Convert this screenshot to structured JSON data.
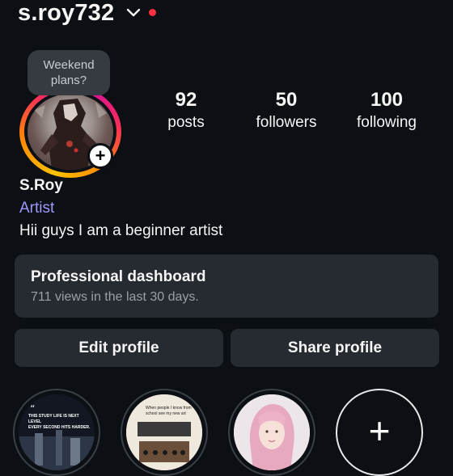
{
  "header": {
    "username": "s.roy732"
  },
  "story_bubble": {
    "line1": "Weekend",
    "line2": "plans?"
  },
  "stats": [
    {
      "value": "92",
      "label": "posts"
    },
    {
      "value": "50",
      "label": "followers"
    },
    {
      "value": "100",
      "label": "following"
    }
  ],
  "profile": {
    "name": "S.Roy",
    "category": "Artist",
    "bio": "Hii guys I am a beginner artist"
  },
  "dashboard": {
    "title": "Professional dashboard",
    "subtitle": "711 views in the last 30 days."
  },
  "buttons": {
    "edit": "Edit profile",
    "share": "Share profile"
  },
  "highlight_text": {
    "h1": [
      "THIS STUDY LIFE IS NEXT LEVEL",
      "EVERY SECOND HITS HARDER."
    ],
    "h2": [
      "When people I know from",
      "school see my new art"
    ]
  },
  "colors": {
    "accent": "#a197ff",
    "notification_dot": "#ff3041",
    "card_bg": "#262a31"
  }
}
